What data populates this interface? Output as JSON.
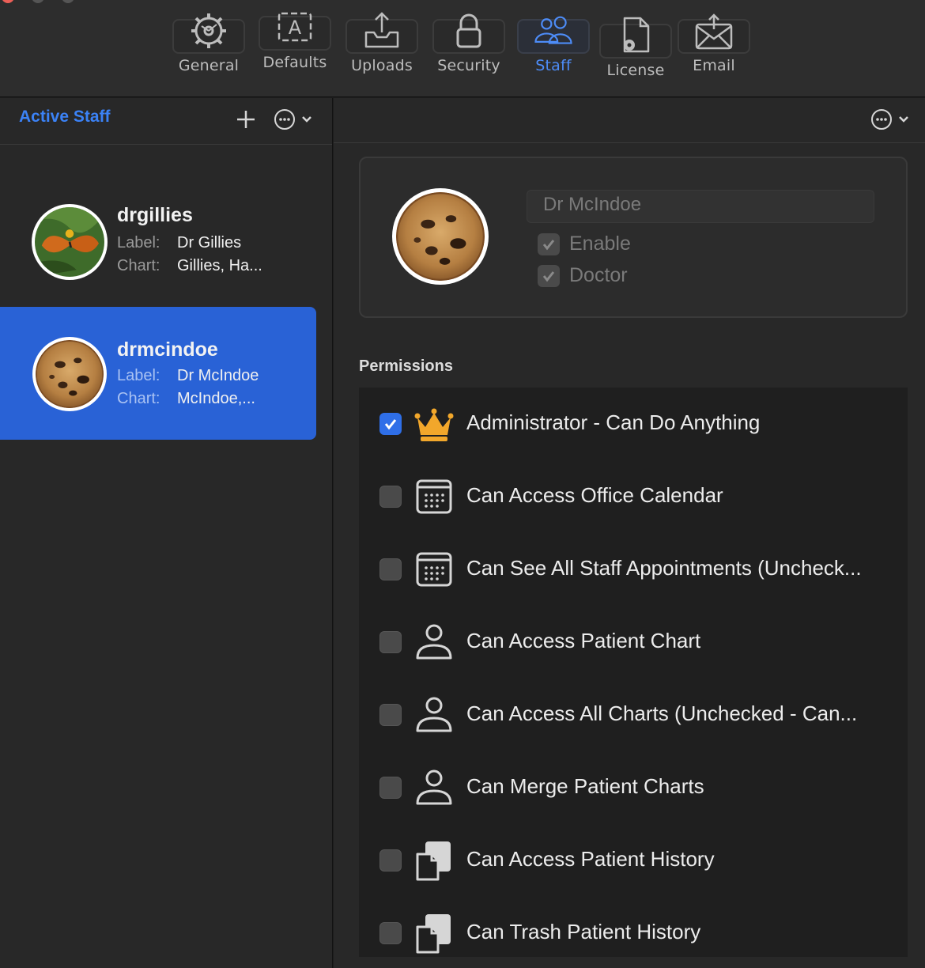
{
  "toolbar": {
    "tabs": [
      {
        "label": "General",
        "icon": "gear-icon"
      },
      {
        "label": "Defaults",
        "icon": "text-format-icon"
      },
      {
        "label": "Uploads",
        "icon": "upload-tray-icon"
      },
      {
        "label": "Security",
        "icon": "lock-icon"
      },
      {
        "label": "Staff",
        "icon": "people-icon",
        "active": true
      },
      {
        "label": "License",
        "icon": "document-gear-icon"
      },
      {
        "label": "Email",
        "icon": "envelope-icon"
      }
    ],
    "accent": "#4d8cf7"
  },
  "sidebar": {
    "title": "Active Staff",
    "label_key": "Label:",
    "chart_key": "Chart:",
    "staff": [
      {
        "username": "drgillies",
        "label": "Dr Gillies",
        "chart": "Gillies, Ha...",
        "avatar": "butterfly-photo"
      },
      {
        "username": "drmcindoe",
        "label": "Dr McIndoe",
        "chart": "McIndoe,...",
        "avatar": "cookie-photo",
        "selected": true
      }
    ],
    "selected_color": "#2962d6"
  },
  "detail": {
    "name_value": "Dr McIndoe",
    "enable_label": "Enable",
    "doctor_label": "Doctor",
    "permissions_title": "Permissions",
    "permissions": [
      {
        "label": "Administrator - Can Do Anything",
        "checked": true,
        "icon": "crown-icon"
      },
      {
        "label": "Can Access Office Calendar",
        "checked": false,
        "icon": "calendar-icon"
      },
      {
        "label": "Can See All Staff Appointments (Uncheck...",
        "checked": false,
        "icon": "calendar-icon"
      },
      {
        "label": "Can Access Patient Chart",
        "checked": false,
        "icon": "person-icon"
      },
      {
        "label": "Can Access All Charts (Unchecked - Can...",
        "checked": false,
        "icon": "person-icon"
      },
      {
        "label": "Can Merge Patient Charts",
        "checked": false,
        "icon": "person-icon"
      },
      {
        "label": "Can Access Patient History",
        "checked": false,
        "icon": "clipboard-icon"
      },
      {
        "label": "Can Trash Patient History",
        "checked": false,
        "icon": "clipboard-icon"
      }
    ]
  }
}
